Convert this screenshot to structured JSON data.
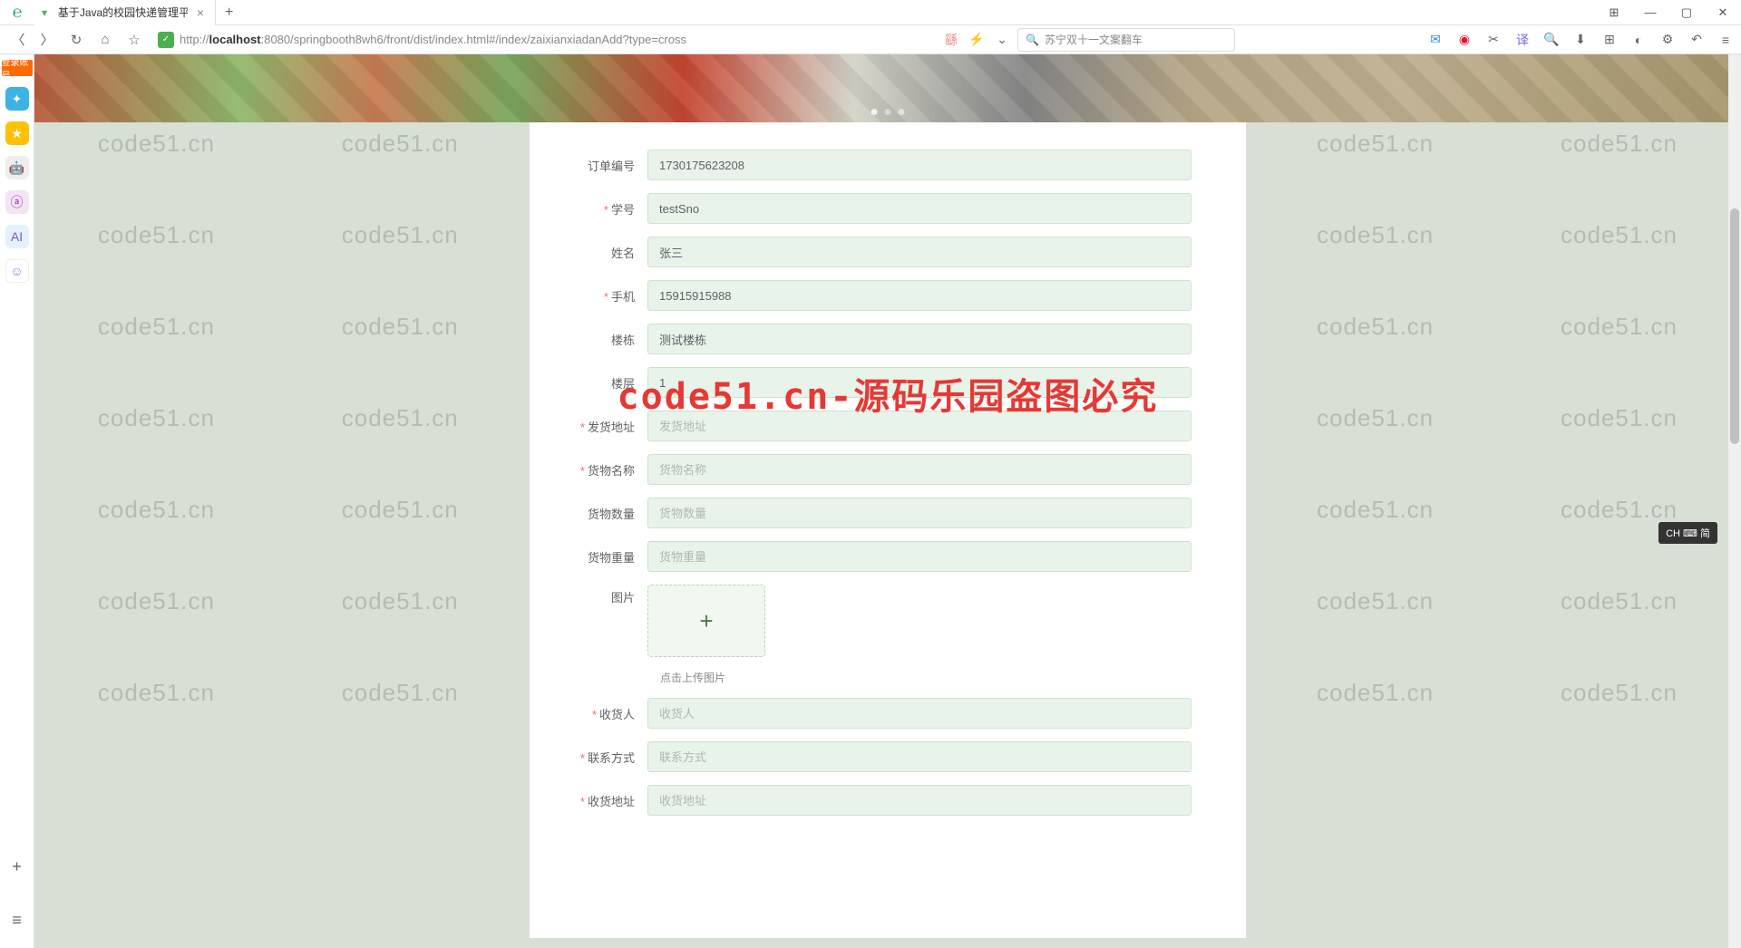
{
  "window": {
    "tab_title": "基于Java的校园快递管理平台的",
    "url_prefix": "http://",
    "url_host": "localhost",
    "url_path": ":8080/springbooth8wh6/front/dist/index.html#/index/zaixianxiadanAdd?type=cross",
    "search_placeholder": "苏宁双十一文案翻车",
    "login_badge": "登录账号"
  },
  "form": {
    "order_no": {
      "label": "订单编号",
      "value": "1730175623208"
    },
    "student_no": {
      "label": "学号",
      "value": "testSno"
    },
    "name": {
      "label": "姓名",
      "value": "张三"
    },
    "phone": {
      "label": "手机",
      "value": "15915915988"
    },
    "building": {
      "label": "楼栋",
      "value": "测试楼栋"
    },
    "floor": {
      "label": "楼层",
      "value": "1"
    },
    "ship_addr": {
      "label": "发货地址",
      "value": "",
      "placeholder": "发货地址"
    },
    "goods_name": {
      "label": "货物名称",
      "value": "",
      "placeholder": "货物名称"
    },
    "goods_qty": {
      "label": "货物数量",
      "value": "",
      "placeholder": "货物数量"
    },
    "goods_weight": {
      "label": "货物重量",
      "value": "",
      "placeholder": "货物重量"
    },
    "image": {
      "label": "图片",
      "hint": "点击上传图片"
    },
    "receiver": {
      "label": "收货人",
      "value": "",
      "placeholder": "收货人"
    },
    "contact": {
      "label": "联系方式",
      "value": "",
      "placeholder": "联系方式"
    },
    "recv_addr": {
      "label": "收货地址",
      "value": "",
      "placeholder": "收货地址"
    }
  },
  "watermark": {
    "text": "code51.cn",
    "big": "code51.cn-源码乐园盗图必究"
  },
  "ime": "CH ⌨ 简"
}
